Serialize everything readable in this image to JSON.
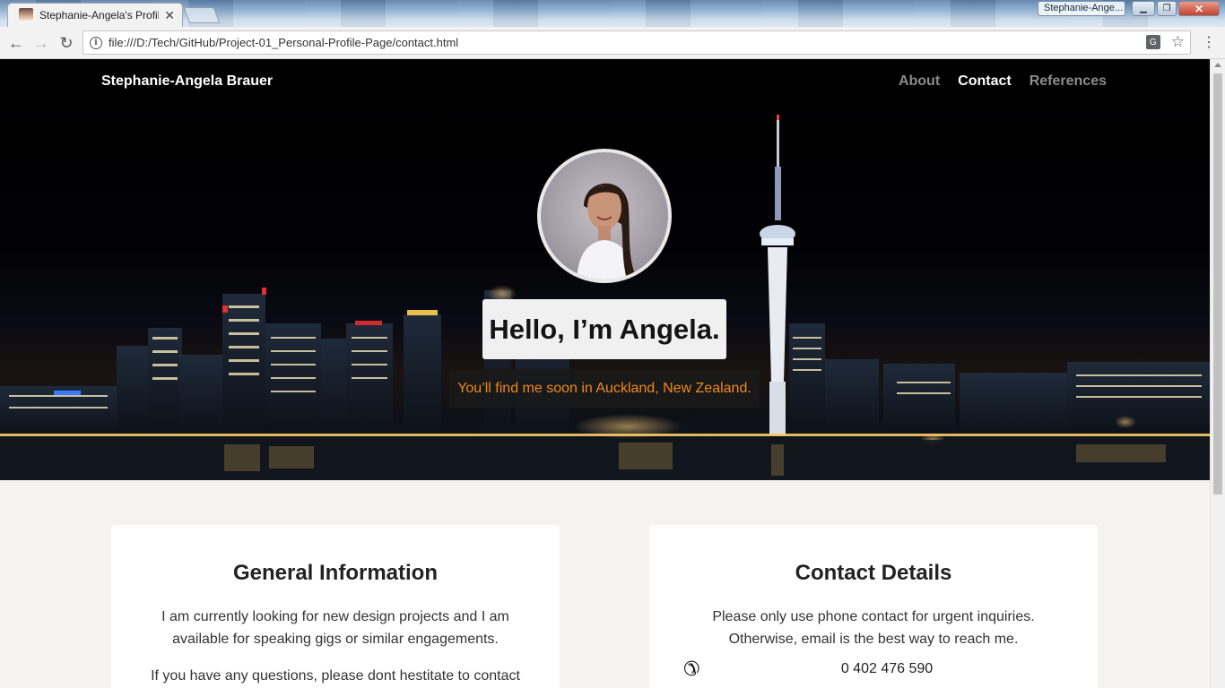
{
  "browser": {
    "tab_title": "Stephanie-Angela's Profil",
    "window_label": "Stephanie-Ange...",
    "url": "file:///D:/Tech/GitHub/Project-01_Personal-Profile-Page/contact.html",
    "icons": [
      "back-arrow-icon",
      "forward-arrow-icon",
      "reload-icon",
      "info-icon",
      "translate-icon",
      "star-icon",
      "menu-icon",
      "close-icon"
    ]
  },
  "navbar": {
    "brand": "Stephanie-Angela Brauer",
    "links": [
      {
        "label": "About",
        "active": false
      },
      {
        "label": "Contact",
        "active": true
      },
      {
        "label": "References",
        "active": false
      }
    ]
  },
  "hero": {
    "title": "Hello, I’m Angela.",
    "subtitle": "You’ll find me soon in Auckland, New Zealand."
  },
  "general_info": {
    "heading": "General Information",
    "p1": "I am currently looking for new design projects and I am available for speaking gigs or similar engagements.",
    "p2": "If you have any questions, please dont hestitate to contact"
  },
  "contact_details": {
    "heading": "Contact Details",
    "p1": "Please only use phone contact for urgent inquiries. Otherwise, email is the best way to reach me.",
    "phone": "0 402 476 590"
  },
  "colors": {
    "accent": "#f08a1a",
    "page_bg": "#f4f3ef",
    "nav_inactive": "#8c8c8c"
  }
}
